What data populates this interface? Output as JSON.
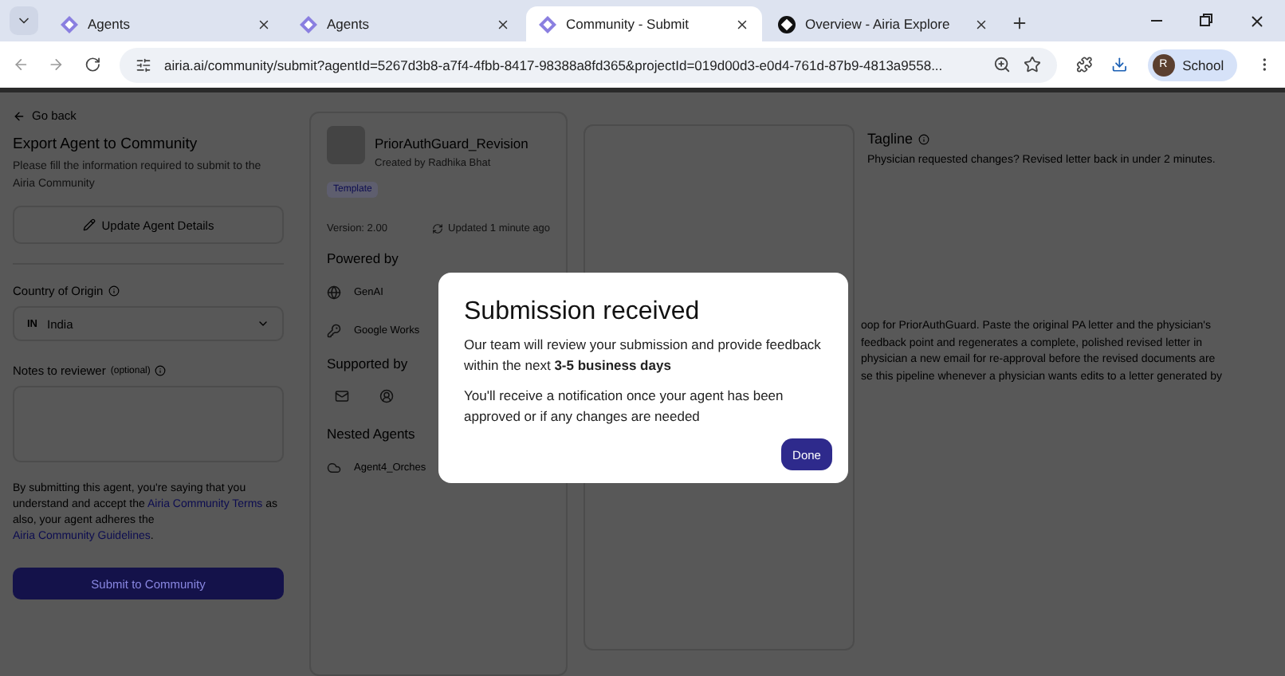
{
  "browser": {
    "tabs": [
      {
        "title": "Agents",
        "selected": false
      },
      {
        "title": "Agents",
        "selected": false
      },
      {
        "title": "Community - Submit",
        "selected": true
      },
      {
        "title": "Overview - Airia Explore",
        "selected": false
      }
    ],
    "address": "airia.ai/community/submit?agentId=5267d3b8-a7f4-4fbb-8417-98388a8fd365&projectId=019d00d3-e0d4-761d-87b9-4813a9558...",
    "profile": {
      "initial": "R",
      "label": "School"
    }
  },
  "form": {
    "back": "Go back",
    "title": "Export Agent to Community",
    "subtitle": "Please fill the information required to submit to the Airia Community",
    "update_button": "Update Agent Details",
    "country": {
      "label": "Country of Origin",
      "code": "IN",
      "value": "India"
    },
    "notes": {
      "label": "Notes to reviewer",
      "hint": "(optional)"
    },
    "disclaimer": [
      {
        "text": "By submitting this agent, you're saying that you understand and accept the ",
        "kind": "text"
      },
      {
        "text": "Airia Community Terms",
        "kind": "link"
      },
      {
        "text": " as also, your agent adheres the ",
        "kind": "text"
      },
      {
        "text": "Airia Community Guidelines",
        "kind": "link"
      },
      {
        "text": ".",
        "kind": "text"
      }
    ],
    "submit_button": "Submit to Community"
  },
  "agent": {
    "name": "PriorAuthGuard_Revision",
    "author": "Created by Radhika Bhat",
    "badge": "Template",
    "version": "Version: 2.00",
    "updated": "Updated 1 minute ago",
    "powered_by": {
      "title": "Powered by",
      "items": [
        {
          "label": "GenAI"
        },
        {
          "label": "Google Works"
        }
      ]
    },
    "supported_by": {
      "title": "Supported by"
    },
    "nested": {
      "title": "Nested Agents",
      "items": [
        {
          "label": "Agent4_Orches"
        }
      ]
    }
  },
  "tagline": {
    "title": "Tagline",
    "text": "Physician requested changes? Revised letter back in under 2 minutes."
  },
  "description_lines": [
    "oop for PriorAuthGuard. Paste the original PA letter and the physician's",
    "feedback point and regenerates a complete, polished revised letter in",
    "physician a new email for re-approval before the revised documents are",
    "se this pipeline whenever a physician wants edits to a letter generated by"
  ],
  "modal": {
    "title": "Submission received",
    "paragraphs": [
      "Our team will review your submission and provide feedback within the next **3-5 business days**",
      "You'll receive a notification once your agent has been approved or if any changes are needed"
    ],
    "button": "Done"
  }
}
